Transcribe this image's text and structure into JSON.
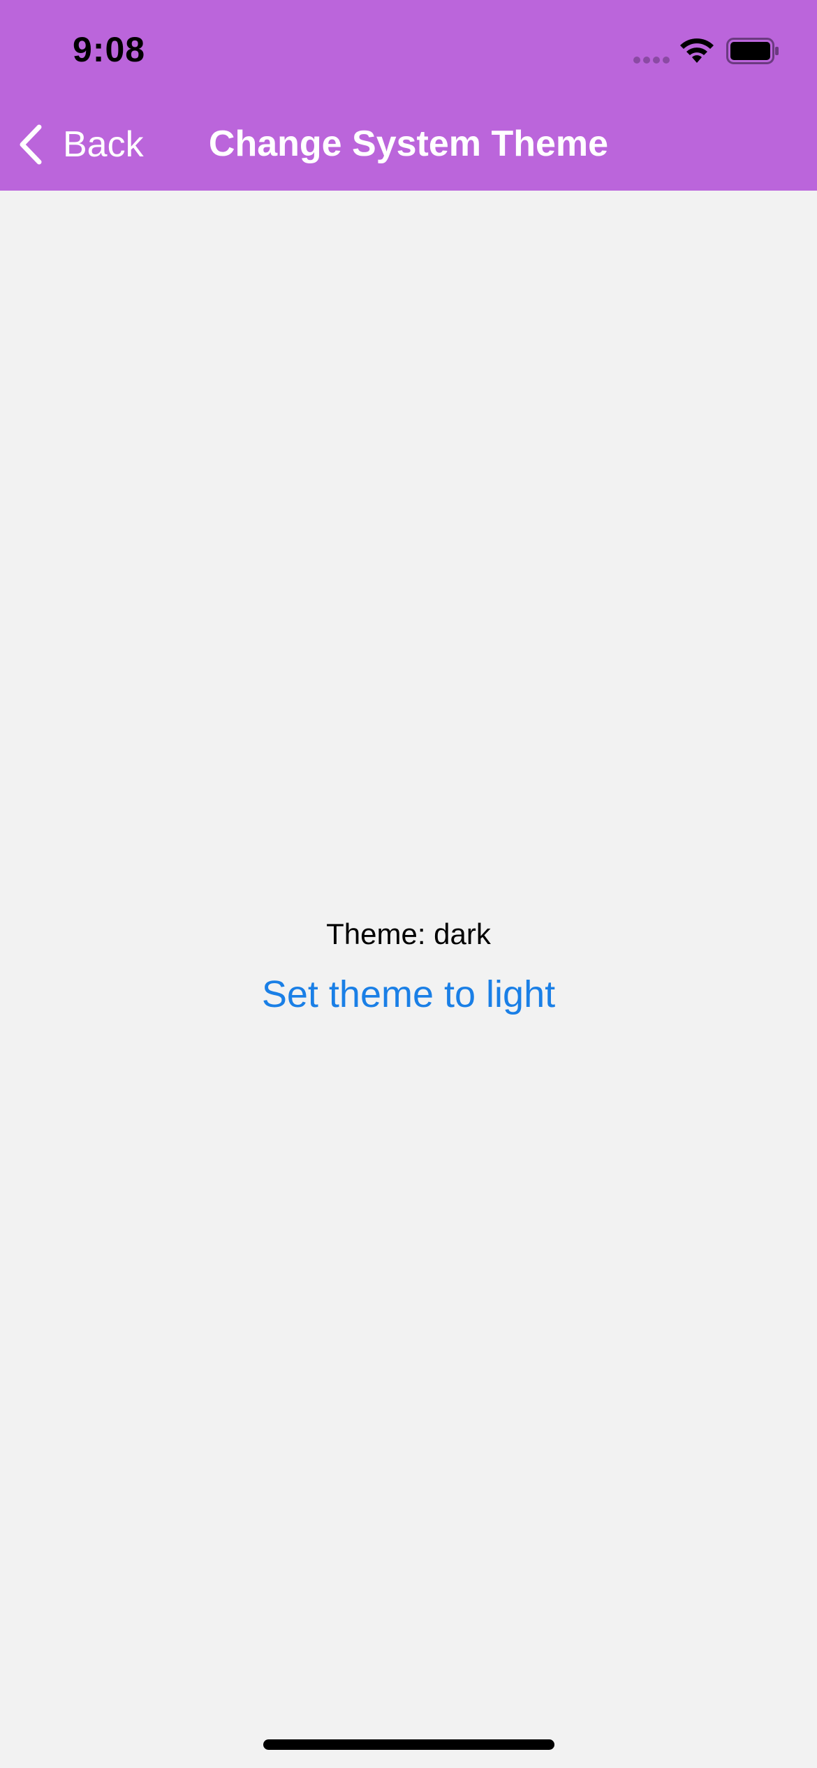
{
  "status_bar": {
    "time": "9:08"
  },
  "nav": {
    "back_label": "Back",
    "title": "Change System Theme"
  },
  "main": {
    "theme_label": "Theme: dark",
    "set_theme_label": "Set theme to light"
  },
  "colors": {
    "header_bg": "#bb65db",
    "content_bg": "#f2f2f2",
    "link": "#1a7fe6"
  },
  "icons": {
    "signal": "cellular-signal-icon",
    "wifi": "wifi-icon",
    "battery": "battery-icon",
    "back": "chevron-left-icon"
  }
}
